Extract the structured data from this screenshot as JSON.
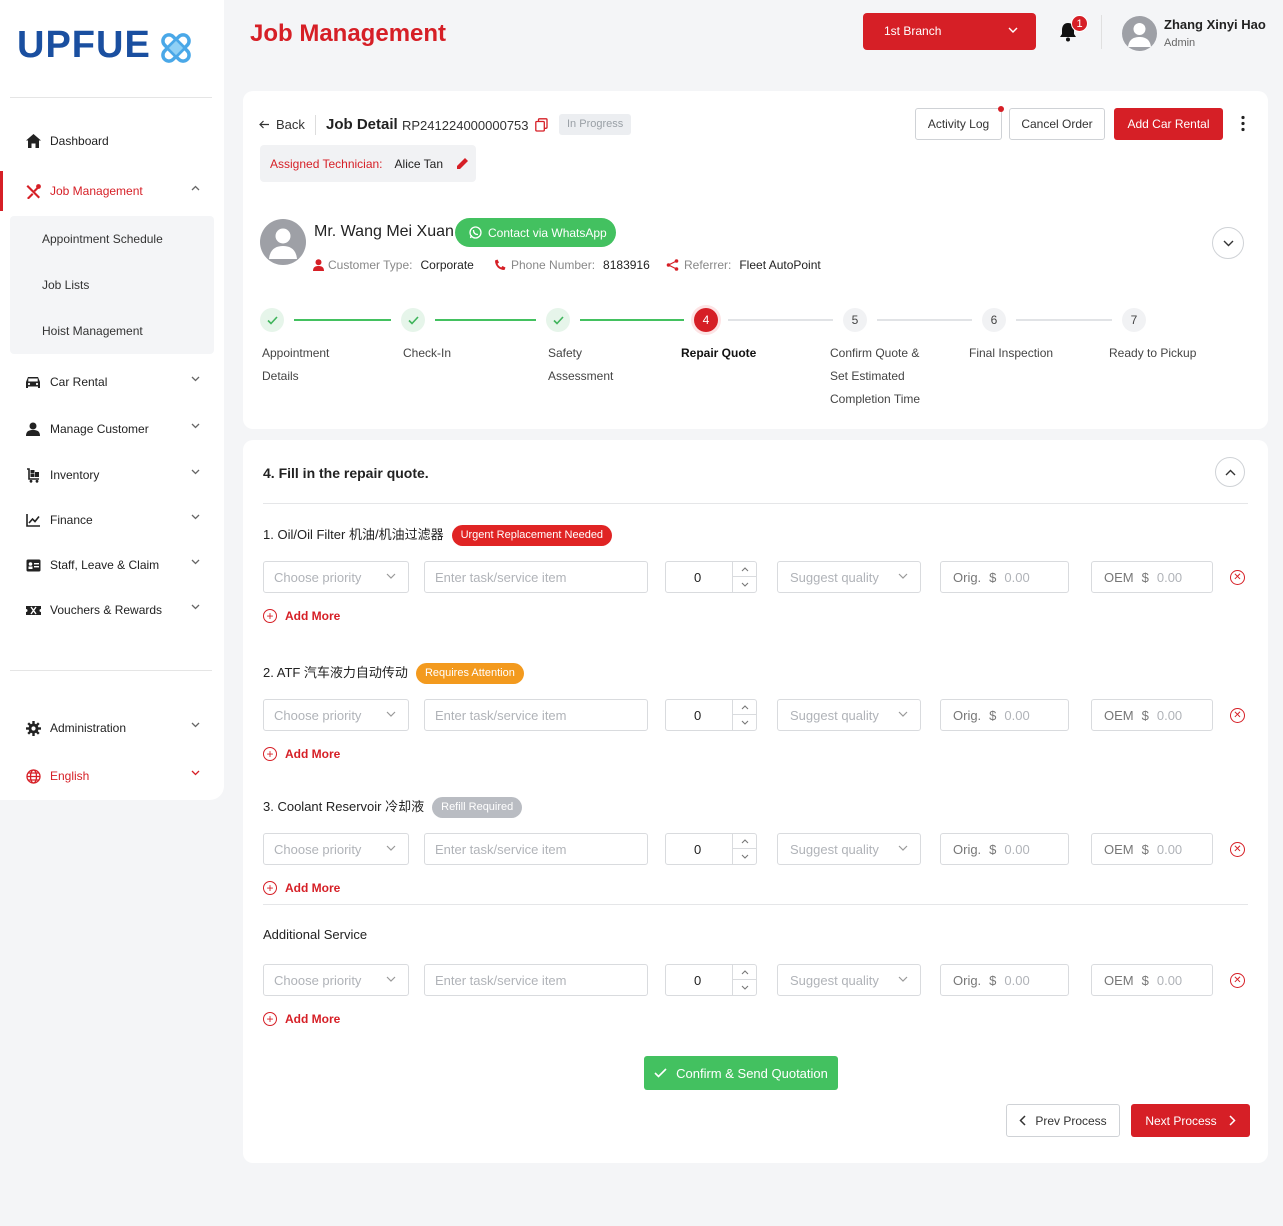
{
  "app": {
    "logo_text": "UPFUE",
    "page_title": "Job Management"
  },
  "header": {
    "branch": "1st Branch",
    "notification_count": "1",
    "user_name": "Zhang Xinyi Hao",
    "user_role": "Admin"
  },
  "sidebar": {
    "items": [
      {
        "label": "Dashboard",
        "icon": "home-icon"
      },
      {
        "label": "Job Management",
        "icon": "tools-icon"
      },
      {
        "label": "Car Rental",
        "icon": "car-icon"
      },
      {
        "label": "Manage Customer",
        "icon": "person-icon"
      },
      {
        "label": "Inventory",
        "icon": "cart-icon"
      },
      {
        "label": "Finance",
        "icon": "chart-icon"
      },
      {
        "label": "Staff, Leave & Claim",
        "icon": "id-card-icon"
      },
      {
        "label": "Vouchers & Rewards",
        "icon": "ticket-icon"
      },
      {
        "label": "Administration",
        "icon": "gear-icon"
      },
      {
        "label": "English",
        "icon": "globe-icon"
      }
    ],
    "submenu": [
      "Appointment Schedule",
      "Job Lists",
      "Hoist Management"
    ]
  },
  "job": {
    "back": "Back",
    "title": "Job Detail",
    "number": "RP241224000000753",
    "status": "In Progress",
    "activity_log": "Activity Log",
    "cancel_order": "Cancel Order",
    "add_car_rental": "Add Car Rental",
    "technician_label": "Assigned Technician:",
    "technician": "Alice Tan"
  },
  "customer": {
    "name": "Mr. Wang Mei Xuan",
    "whatsapp": "Contact via WhatsApp",
    "type_label": "Customer Type:",
    "type": "Corporate",
    "phone_label": "Phone Number:",
    "phone": "8183916",
    "referrer_label": "Referrer:",
    "referrer": "Fleet AutoPoint"
  },
  "steps": [
    {
      "num": "1",
      "label1": "Appointment",
      "label2": "Details",
      "label3": "",
      "state": "done"
    },
    {
      "num": "2",
      "label1": "Check-In",
      "label2": "",
      "label3": "",
      "state": "done"
    },
    {
      "num": "3",
      "label1": "Safety",
      "label2": "Assessment",
      "label3": "",
      "state": "done"
    },
    {
      "num": "4",
      "label1": "Repair Quote",
      "label2": "",
      "label3": "",
      "state": "current"
    },
    {
      "num": "5",
      "label1": "Confirm Quote &",
      "label2": "Set Estimated",
      "label3": "Completion Time",
      "state": "todo"
    },
    {
      "num": "6",
      "label1": "Final Inspection",
      "label2": "",
      "label3": "",
      "state": "todo"
    },
    {
      "num": "7",
      "label1": "Ready to Pickup",
      "label2": "",
      "label3": "",
      "state": "todo"
    }
  ],
  "quote": {
    "heading": "4. Fill in the repair quote.",
    "sections": [
      {
        "title": "1. Oil/Oil Filter 机油/机油过滤器",
        "tag": "Urgent Replacement Needed",
        "tag_color": "#e02424"
      },
      {
        "title": "2. ATF 汽车液力自动传动",
        "tag": "Requires Attention",
        "tag_color": "#f39a1e"
      },
      {
        "title": "3. Coolant Reservoir 冷却液",
        "tag": "Refill Required",
        "tag_color": "#b9bcc2"
      },
      {
        "title": "Additional Service",
        "tag": "",
        "tag_color": ""
      }
    ],
    "row": {
      "priority_placeholder": "Choose priority",
      "task_placeholder": "Enter task/service item",
      "qty": "0",
      "quality_placeholder": "Suggest quality",
      "orig_label": "Orig.",
      "oem_label": "OEM",
      "currency": "$",
      "price_placeholder": "0.00"
    },
    "add_more": "Add More",
    "confirm": "Confirm & Send Quotation",
    "prev": "Prev Process",
    "next": "Next Process"
  },
  "colors": {
    "accent": "#d61f26",
    "success": "#43c160",
    "logo_blue": "#1a4fa0"
  }
}
